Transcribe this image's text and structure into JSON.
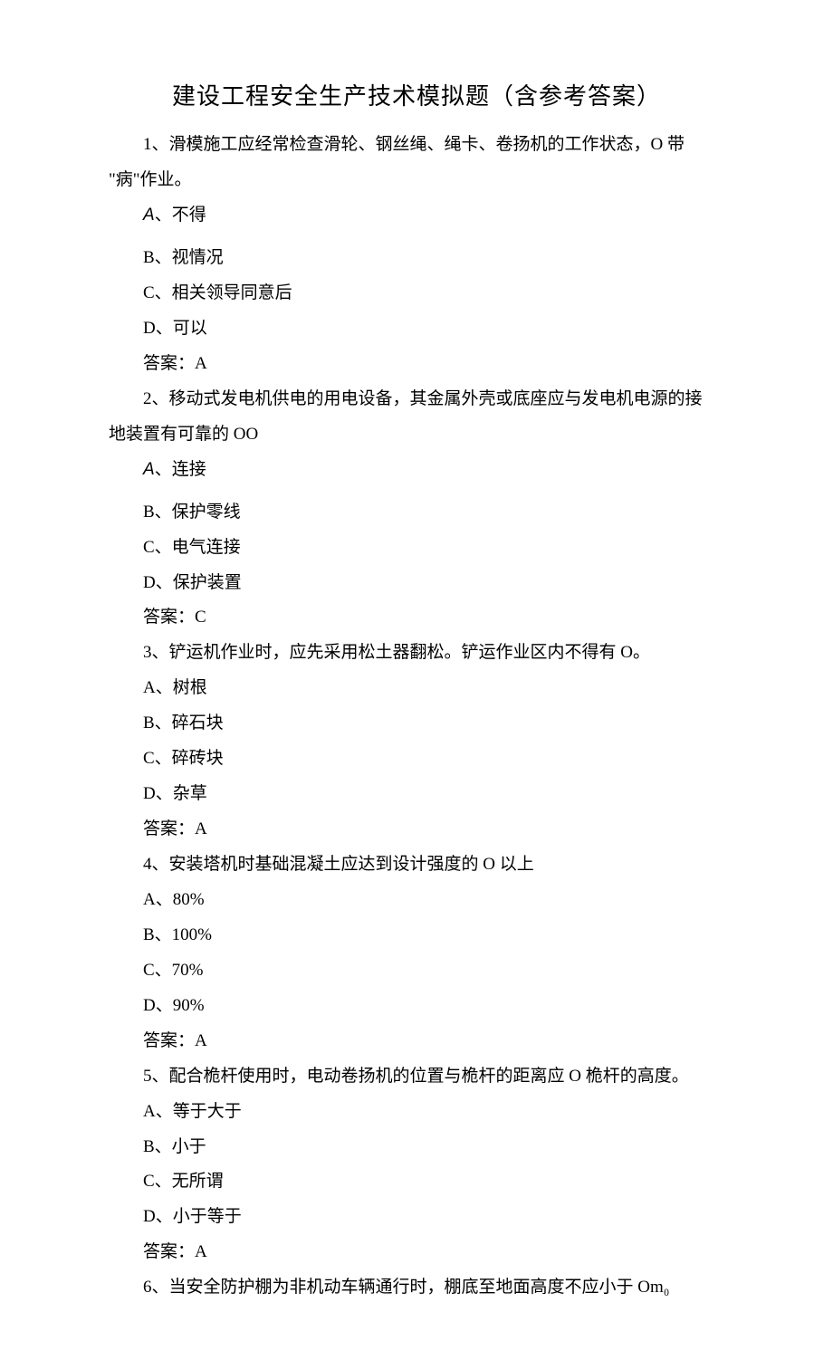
{
  "title": "建设工程安全生产技术模拟题（含参考答案）",
  "questions": [
    {
      "num": "1、",
      "text_part1": "滑模施工应经常检查滑轮、钢丝绳、绳卡、卷扬机的工作状态，O 带",
      "text_part2": "\"病\"作业。",
      "options": {
        "a_label": "A",
        "a_text": "、不得",
        "b": "B、视情况",
        "c": "C、相关领导同意后",
        "d": "D、可以"
      },
      "answer": "答案：A"
    },
    {
      "num": "2、",
      "text_part1": "移动式发电机供电的用电设备，其金属外壳或底座应与发电机电源的接",
      "text_part2": "地装置有可靠的 OO",
      "options": {
        "a_label": "A",
        "a_text": "、连接",
        "b": "B、保护零线",
        "c": "C、电气连接",
        "d": "D、保护装置"
      },
      "answer": "答案：C"
    },
    {
      "num": "3、",
      "text_part1": "铲运机作业时，应先采用松土器翻松。铲运作业区内不得有 O。",
      "options": {
        "a": "A、树根",
        "b": "B、碎石块",
        "c": "C、碎砖块",
        "d": "D、杂草"
      },
      "answer": "答案：A"
    },
    {
      "num": "4、",
      "text_part1": "安装塔机时基础混凝土应达到设计强度的 O 以上",
      "options": {
        "a": "A、80%",
        "b": "B、100%",
        "c": "C、70%",
        "d": "D、90%"
      },
      "answer": "答案：A"
    },
    {
      "num": "5、",
      "text_part1": "配合桅杆使用时，电动卷扬机的位置与桅杆的距离应 O 桅杆的高度。",
      "options": {
        "a": "A、等于大于",
        "b": "B、小于",
        "c": "C、无所谓",
        "d": "D、小于等于"
      },
      "answer": "答案：A"
    },
    {
      "num": "6、",
      "text_part1": "当安全防护棚为非机动车辆通行时，棚底至地面高度不应小于 Om₀"
    }
  ]
}
